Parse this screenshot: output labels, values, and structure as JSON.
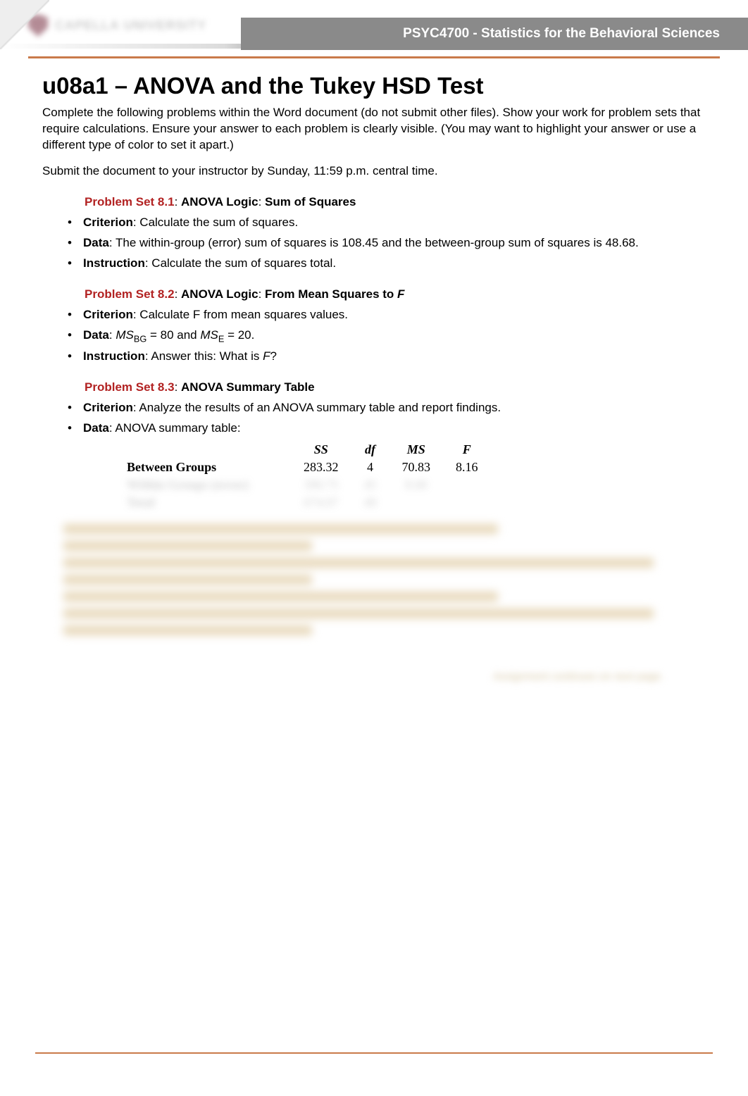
{
  "header": {
    "logo_text": "CAPELLA UNIVERSITY",
    "course": "PSYC4700 - Statistics for the Behavioral Sciences"
  },
  "title": "u08a1 – ANOVA and the Tukey HSD Test",
  "intro1": "Complete the following problems within the Word document (do not submit other files). Show your work for problem sets that require calculations. Ensure your answer to each problem is clearly visible. (You may want to highlight your answer or use a different type of color to set it apart.)",
  "intro2": "Submit the document to your instructor by Sunday, 11:59 p.m. central time.",
  "ps81": {
    "label": "Problem Set 8.1",
    "sep": ": ",
    "topic": "ANOVA Logic",
    "sep2": ": ",
    "subtitle": "Sum of Squares",
    "criterion_label": "Criterion",
    "criterion_text": ": Calculate the sum of squares.",
    "data_label": "Data",
    "data_text": ": The within-group (error) sum of squares is 108.45 and the between-group sum of squares is 48.68.",
    "instruction_label": "Instruction",
    "instruction_text": ": Calculate the sum of squares total."
  },
  "ps82": {
    "label": "Problem Set 8.2",
    "sep": ": ",
    "topic": "ANOVA Logic",
    "sep2": ": ",
    "subtitle_pre": "From Mean Squares to ",
    "subtitle_ital": "F",
    "criterion_label": "Criterion",
    "criterion_text": ": Calculate F from mean squares values.",
    "data_label": "Data",
    "data_pre": ": ",
    "ms_label": "MS",
    "bg_sub": "BG",
    "eq1": "  = 80 and ",
    "e_sub": "E",
    "eq2": "  = 20.",
    "instruction_label": "Instruction",
    "instruction_pre": ": Answer this: What is ",
    "instruction_ital": "F",
    "instruction_post": "?"
  },
  "ps83": {
    "label": "Problem Set 8.3",
    "sep": ": ",
    "subtitle": "ANOVA Summary Table",
    "criterion_label": "Criterion",
    "criterion_text": ": Analyze the results of an ANOVA summary table and report findings.",
    "data_label": "Data",
    "data_text": ": ANOVA summary table:"
  },
  "anova": {
    "headers": {
      "src": "",
      "ss": "SS",
      "df": "df",
      "ms": "MS",
      "f": "F"
    },
    "rows": [
      {
        "src": "Between Groups",
        "ss": "283.32",
        "df": "4",
        "ms": "70.83",
        "f": "8.16"
      },
      {
        "src": "Within Groups (error)",
        "ss": "390.75",
        "df": "45",
        "ms": "8.68",
        "f": ""
      },
      {
        "src": "Total",
        "ss": "674.07",
        "df": "49",
        "ms": "",
        "f": ""
      }
    ]
  },
  "footer_note": "Assignment continues on next page."
}
